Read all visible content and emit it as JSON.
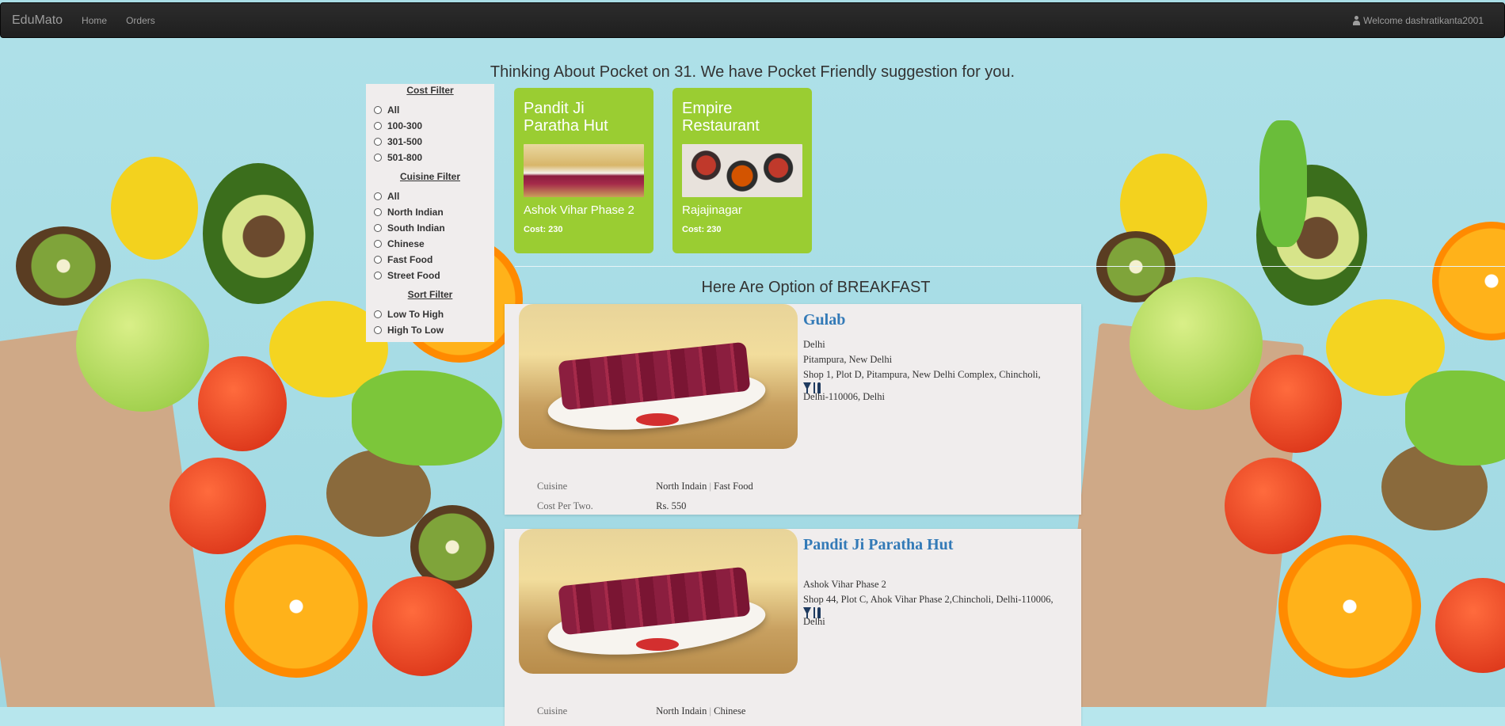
{
  "navbar": {
    "brand": "EduMato",
    "links": [
      "Home",
      "Orders"
    ],
    "welcome": "Welcome dashratikanta2001",
    "icon": "user-icon"
  },
  "headline": "Thinking About Pocket on 31. We have Pocket Friendly suggestion for you.",
  "filters": {
    "cost_title": "Cost Filter",
    "cost_options": [
      "All",
      "100-300",
      "301-500",
      "501-800"
    ],
    "cuisine_title": "Cuisine Filter",
    "cuisine_options": [
      "All",
      "North Indian",
      "South Indian",
      "Chinese",
      "Fast Food",
      "Street Food"
    ],
    "sort_title": "Sort Filter",
    "sort_options": [
      "Low To High",
      "High To Low"
    ]
  },
  "suggestions": [
    {
      "name": "Pandit Ji Paratha Hut",
      "location": "Ashok Vihar Phase 2",
      "cost": "Cost: 230"
    },
    {
      "name": "Empire Restaurant",
      "location": "Rajajinagar",
      "cost": "Cost: 230"
    }
  ],
  "section_title": "Here Are Option of BREAKFAST",
  "restaurants": [
    {
      "name": "Gulab",
      "city": "Delhi",
      "locality": "Pitampura, New Delhi",
      "address_1": "Shop 1, Plot D, Pitampura, New Delhi Complex, Chincholi,",
      "address_2": "Delhi-110006, Delhi",
      "cuisine_label": "Cuisine",
      "cuisine_1": "North Indain",
      "cuisine_2": "Fast Food",
      "cost_label": "Cost Per Two.",
      "cost": "Rs. 550"
    },
    {
      "name": "Pandit Ji Paratha Hut",
      "city": "",
      "locality": "Ashok Vihar Phase 2",
      "address_1": "Shop 44, Plot C, Ahok Vihar Phase 2,Chincholi, Delhi-110006,",
      "address_2": "Delhi",
      "cuisine_label": "Cuisine",
      "cuisine_1": "North Indain",
      "cuisine_2": "Chinese"
    }
  ],
  "colors": {
    "navbar": "#222222",
    "card_green": "#9acd32",
    "link_blue": "#337ab7",
    "panel": "#f0eded"
  }
}
